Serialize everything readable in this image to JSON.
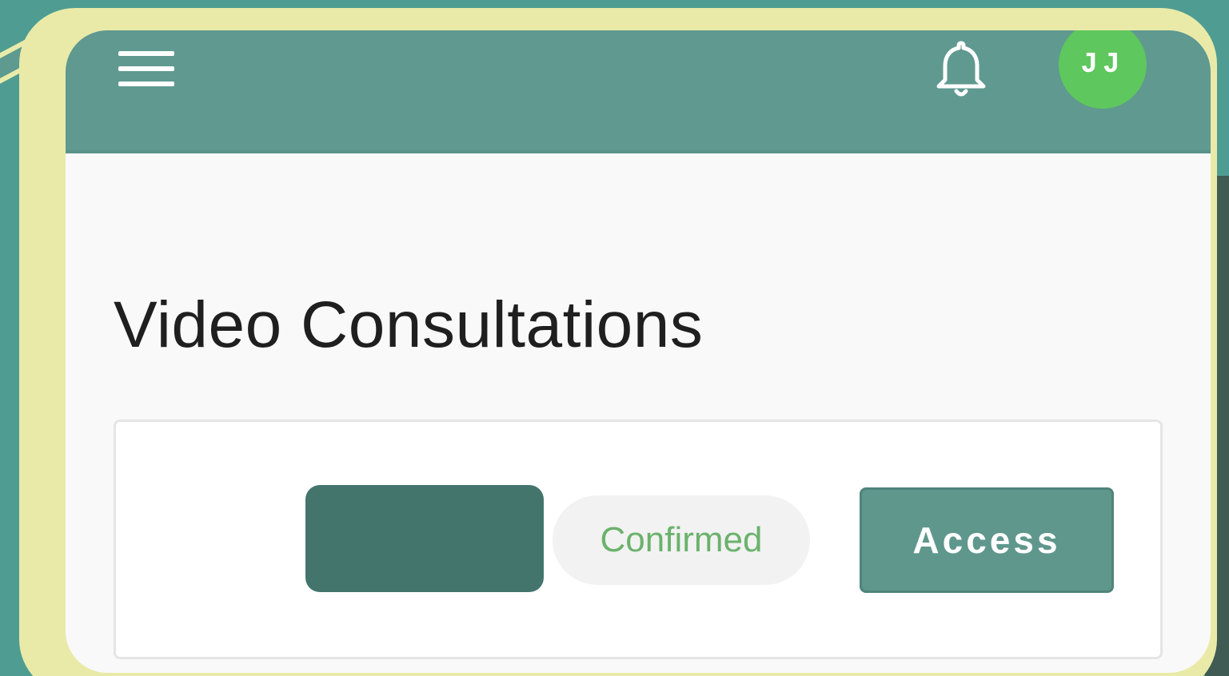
{
  "header": {
    "menu_icon": "hamburger-menu-icon",
    "notification_icon": "bell-icon",
    "avatar_initials": "JJ"
  },
  "main": {
    "title": "Video Consultations",
    "consultation": {
      "time_slot": "",
      "status": "Confirmed",
      "action_label": "Access"
    }
  },
  "colors": {
    "header": "#5f9990",
    "avatar": "#5ec75d",
    "time_chip": "#43756d",
    "status_text": "#6bb26c",
    "button": "#5f978d",
    "frame": "#e9eaa8",
    "background": "#4f9d92"
  }
}
